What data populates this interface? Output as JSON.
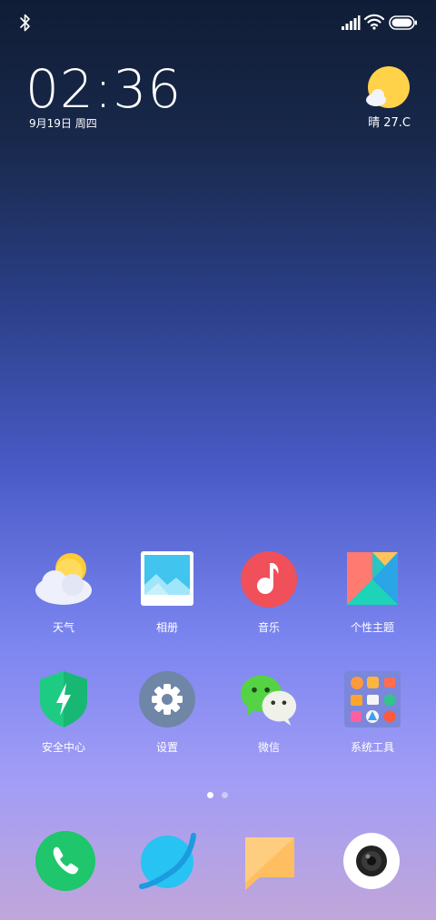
{
  "status_bar": {
    "icons": [
      "bluetooth-icon",
      "signal-icon",
      "wifi-icon",
      "battery-icon"
    ]
  },
  "clock_widget": {
    "time": "02:36",
    "date": "9月19日 周四",
    "weather": "晴  27.C",
    "weather_icon": "sun-cloud-icon"
  },
  "app_grid": [
    {
      "label": "天气",
      "icon": "weather-icon"
    },
    {
      "label": "相册",
      "icon": "gallery-icon"
    },
    {
      "label": "音乐",
      "icon": "music-icon"
    },
    {
      "label": "个性主题",
      "icon": "themes-icon"
    },
    {
      "label": "安全中心",
      "icon": "security-icon"
    },
    {
      "label": "设置",
      "icon": "settings-icon"
    },
    {
      "label": "微信",
      "icon": "wechat-icon"
    },
    {
      "label": "系统工具",
      "icon": "tools-folder-icon"
    }
  ],
  "page_indicator": {
    "pages": 2,
    "current": 1
  },
  "dock": [
    {
      "icon": "phone-icon"
    },
    {
      "icon": "browser-icon"
    },
    {
      "icon": "messages-icon"
    },
    {
      "icon": "camera-icon"
    }
  ],
  "colors": {
    "phone": "#1fc66b",
    "browser": "#27c3f3",
    "messages": "#ffbf60",
    "music": "#f0505a",
    "security": "#1ecb83",
    "settings": "#6f86a6"
  }
}
